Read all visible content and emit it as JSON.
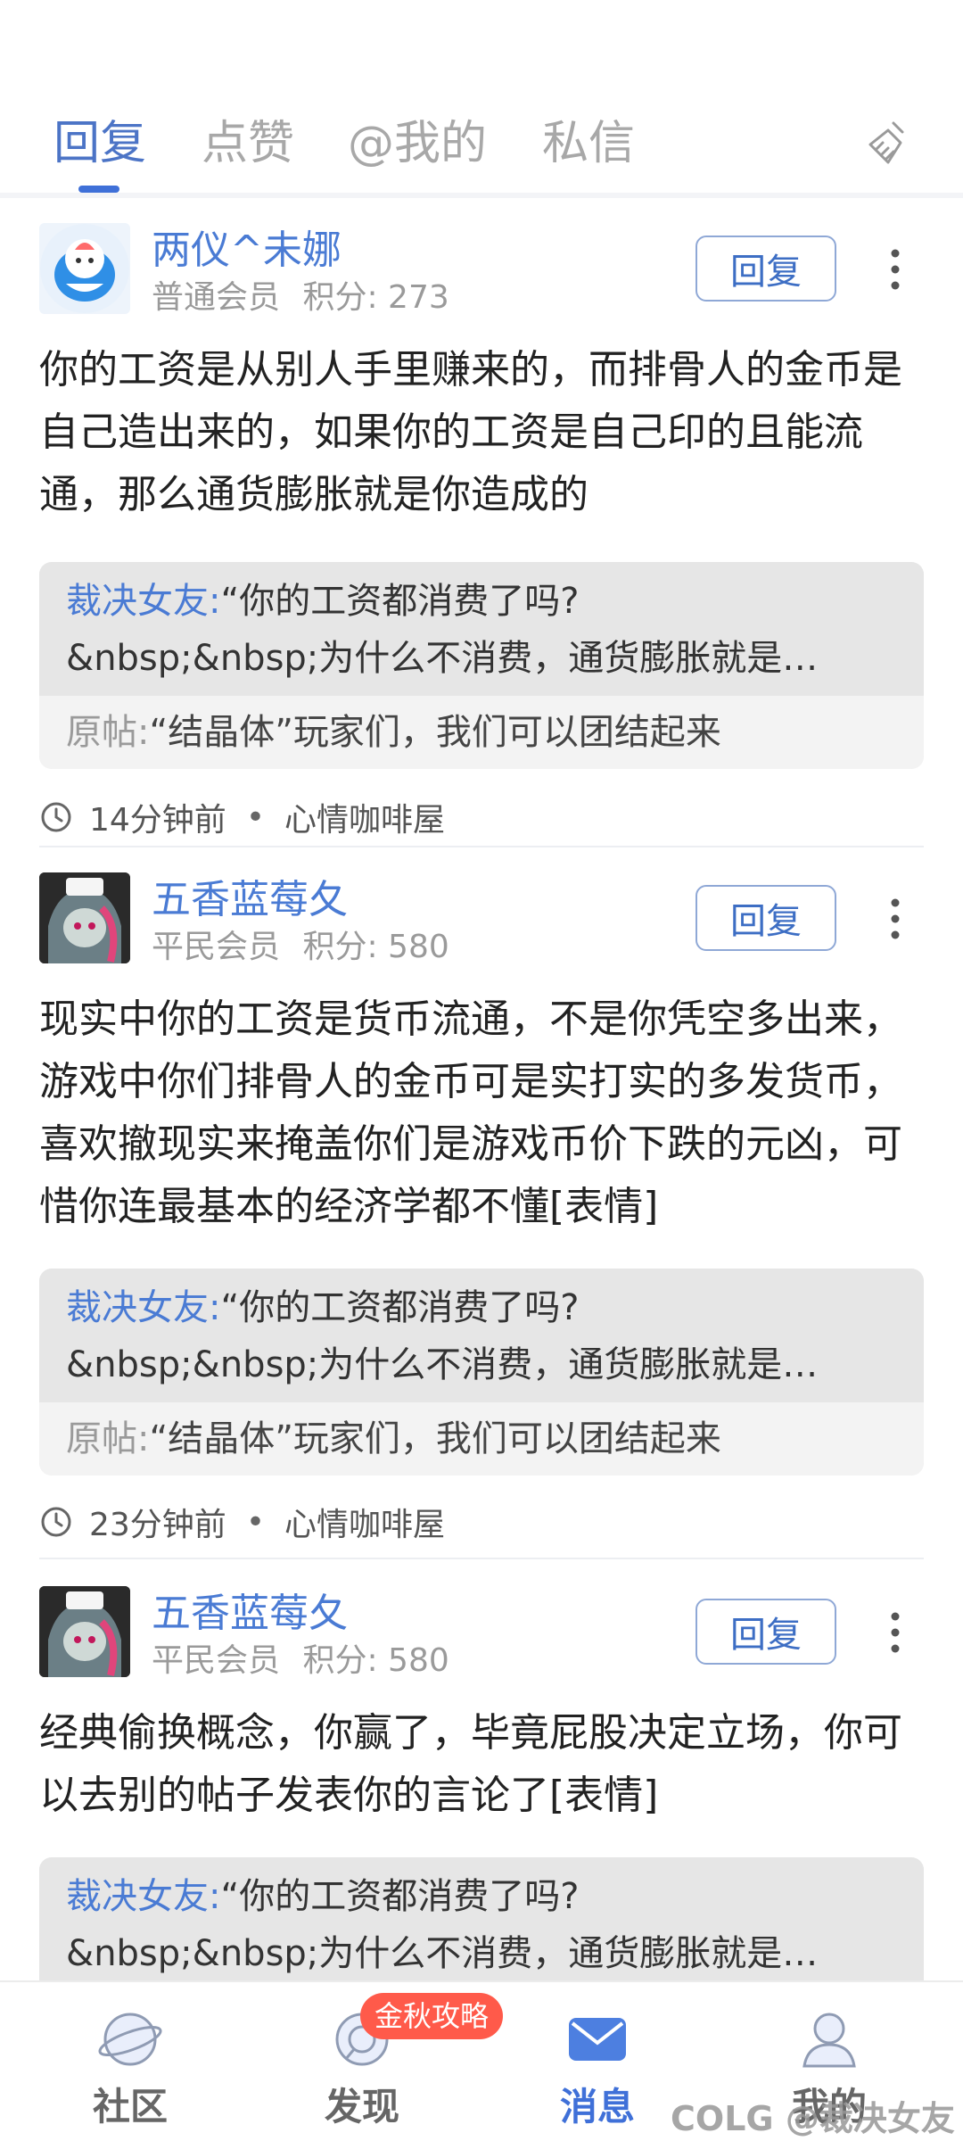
{
  "tabs": [
    {
      "label": "回复",
      "active": true
    },
    {
      "label": "点赞",
      "active": false
    },
    {
      "label": "@我的",
      "active": false
    },
    {
      "label": "私信",
      "active": false
    }
  ],
  "items": [
    {
      "username": "两仪^未娜",
      "member_level": "普通会员",
      "points_label": "积分: 273",
      "reply_label": "回复",
      "content": "你的工资是从别人手里赚来的，而排骨人的金币是自己造出来的，如果你的工资是自己印的且能流通，那么通货膨胀就是你造成的",
      "quote_name": "裁决女友:",
      "quote_line1": "“你的工资都消费了吗?",
      "quote_line2": "&nbsp;&nbsp;为什么不消费，通货膨胀就是…",
      "origin_label": "原帖:",
      "origin_title": "“结晶体”玩家们，我们可以团结起来",
      "time": "14分钟前",
      "forum": "心情咖啡屋"
    },
    {
      "username": "五香蓝莓夂",
      "member_level": "平民会员",
      "points_label": "积分: 580",
      "reply_label": "回复",
      "content": "现实中你的工资是货币流通，不是你凭空多出来，游戏中你们排骨人的金币可是实打实的多发货币，喜欢撤现实来掩盖你们是游戏币价下跌的元凶，可惜你连最基本的经济学都不懂[表情]",
      "quote_name": "裁决女友:",
      "quote_line1": "“你的工资都消费了吗?",
      "quote_line2": "&nbsp;&nbsp;为什么不消费，通货膨胀就是…",
      "origin_label": "原帖:",
      "origin_title": "“结晶体”玩家们，我们可以团结起来",
      "time": "23分钟前",
      "forum": "心情咖啡屋"
    },
    {
      "username": "五香蓝莓夂",
      "member_level": "平民会员",
      "points_label": "积分: 580",
      "reply_label": "回复",
      "content": "经典偷换概念，你赢了，毕竟屁股决定立场，你可以去别的帖子发表你的言论了[表情]",
      "quote_name": "裁决女友:",
      "quote_line1": "“你的工资都消费了吗?",
      "quote_line2": "&nbsp;&nbsp;为什么不消费，通货膨胀就是…"
    }
  ],
  "bottom_nav": [
    {
      "label": "社区",
      "icon": "planet-icon",
      "active": false
    },
    {
      "label": "发现",
      "icon": "discover-icon",
      "active": false
    },
    {
      "label": "消息",
      "icon": "envelope-icon",
      "active": true
    },
    {
      "label": "我的",
      "icon": "user-icon",
      "active": false
    }
  ],
  "badge": "金秋攻略",
  "watermark": "COLG @裁决女友",
  "colors": {
    "accent": "#3f70d8",
    "username": "#4a7bd4",
    "badge": "#ff5a4a"
  }
}
